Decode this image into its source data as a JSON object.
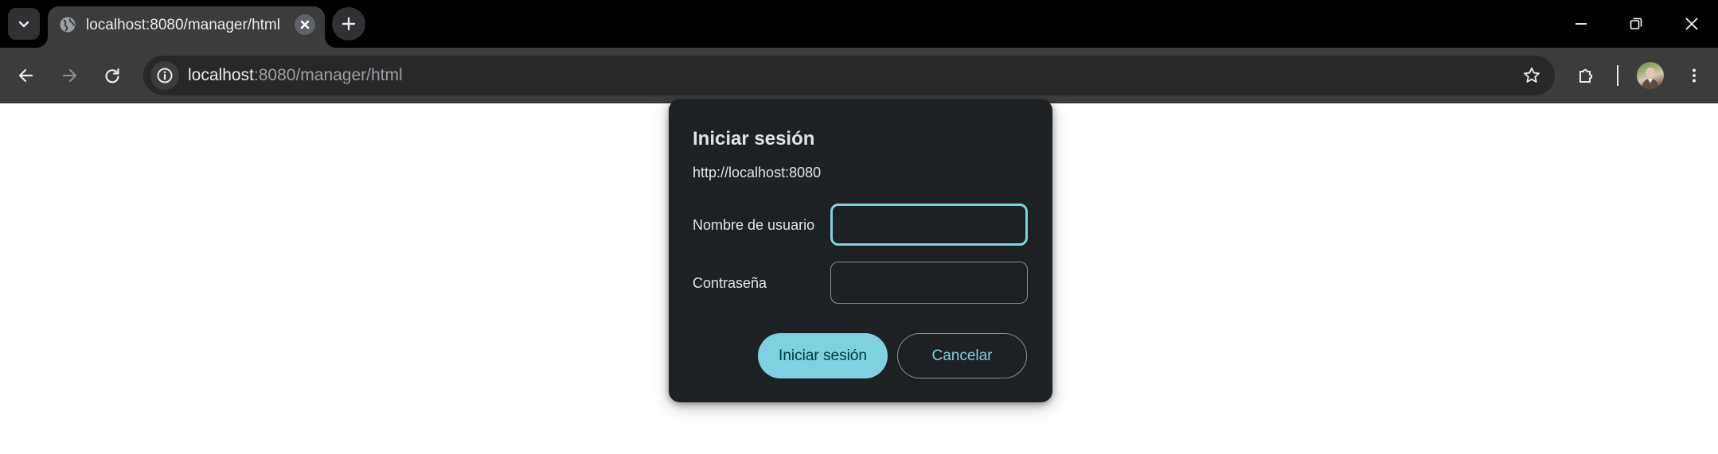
{
  "browser": {
    "tab": {
      "title": "localhost:8080/manager/html",
      "favicon": "globe-icon"
    },
    "address_bar": {
      "host": "localhost",
      "rest": ":8080/manager/html"
    },
    "icons": {
      "tab_search": "chevron-down-icon",
      "tab_close": "close-icon",
      "new_tab": "plus-icon",
      "minimize": "minimize-icon",
      "restore": "restore-icon",
      "close_window": "close-icon",
      "back": "back-arrow-icon",
      "forward": "forward-arrow-icon",
      "reload": "reload-icon",
      "site_info": "info-icon",
      "bookmark": "star-icon",
      "extensions": "puzzle-icon",
      "menu": "more-vert-icon"
    }
  },
  "dialog": {
    "title": "Iniciar sesión",
    "origin": "http://localhost:8080",
    "username_label": "Nombre de usuario",
    "username_value": "",
    "password_label": "Contraseña",
    "password_value": "",
    "submit_label": "Iniciar sesión",
    "cancel_label": "Cancelar"
  },
  "colors": {
    "accent": "#7dd1e0",
    "dialog_bg": "#1d2124",
    "toolbar_bg": "#3c3c3c",
    "titlebar_bg": "#000000"
  }
}
